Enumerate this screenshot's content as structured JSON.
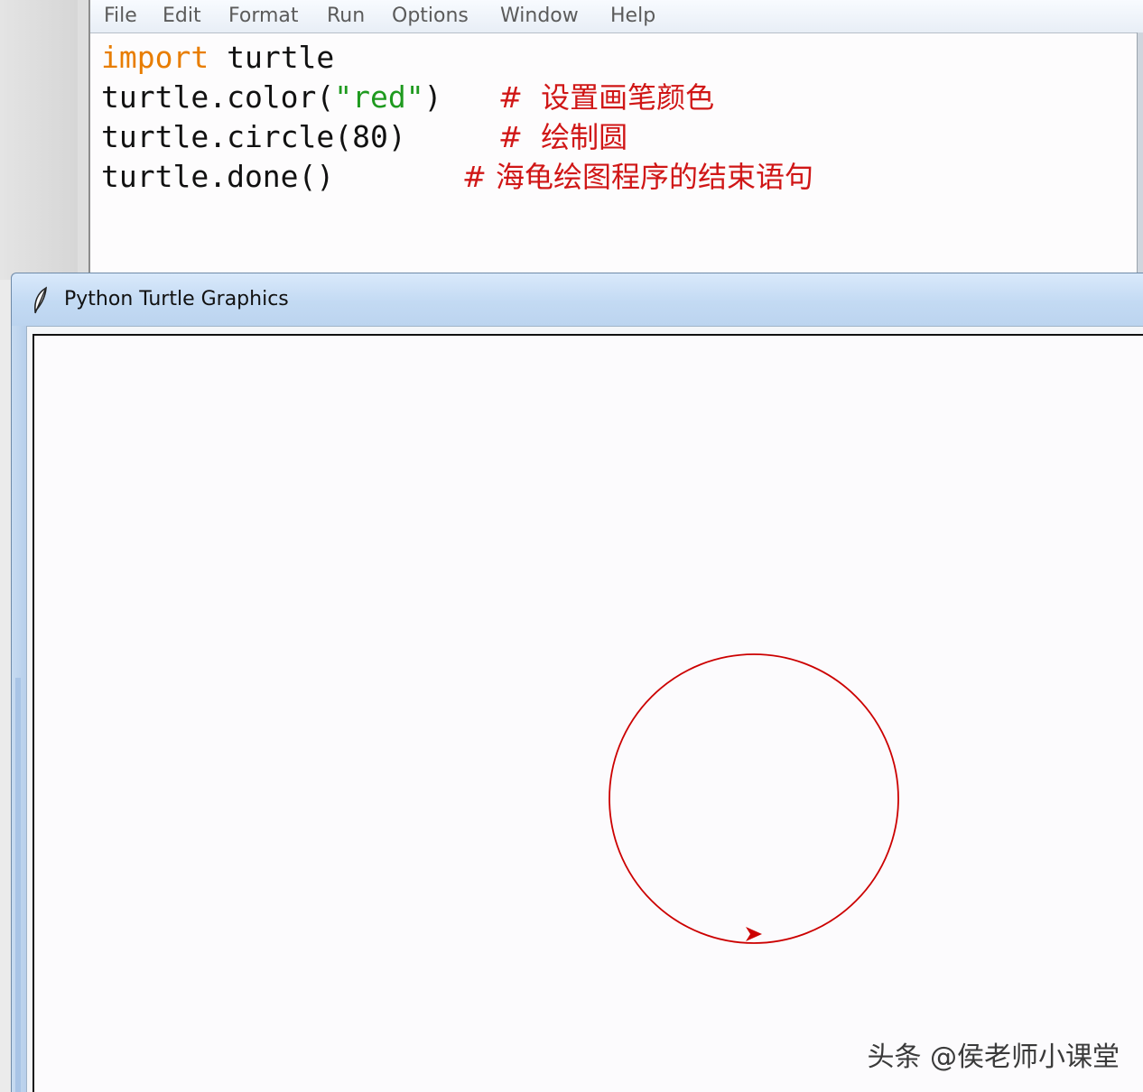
{
  "editor": {
    "menu": [
      "File",
      "Edit",
      "Format",
      "Run",
      "Options",
      "Window",
      "Help"
    ],
    "code": {
      "line1": {
        "keyword": "import",
        "rest": " turtle"
      },
      "line2": {
        "pre": "turtle.color(",
        "string": "\"red\"",
        "post": ")",
        "comment": "#  设置画笔颜色"
      },
      "line3": {
        "code": "turtle.circle(80)",
        "comment": "#  绘制圆"
      },
      "line4": {
        "code": "turtle.done()",
        "comment": "# 海龟绘图程序的结束语句"
      }
    }
  },
  "turtle_window": {
    "title": "Python Turtle Graphics",
    "icon": "feather-icon",
    "drawing": {
      "shape": "circle",
      "color": "#cc0000",
      "turtle_heading": "east"
    }
  },
  "watermark": "头条 @侯老师小课堂",
  "colors": {
    "keyword": "#e87d00",
    "string": "#1f9a1f",
    "comment": "#d01616",
    "pen": "#cc0000"
  }
}
